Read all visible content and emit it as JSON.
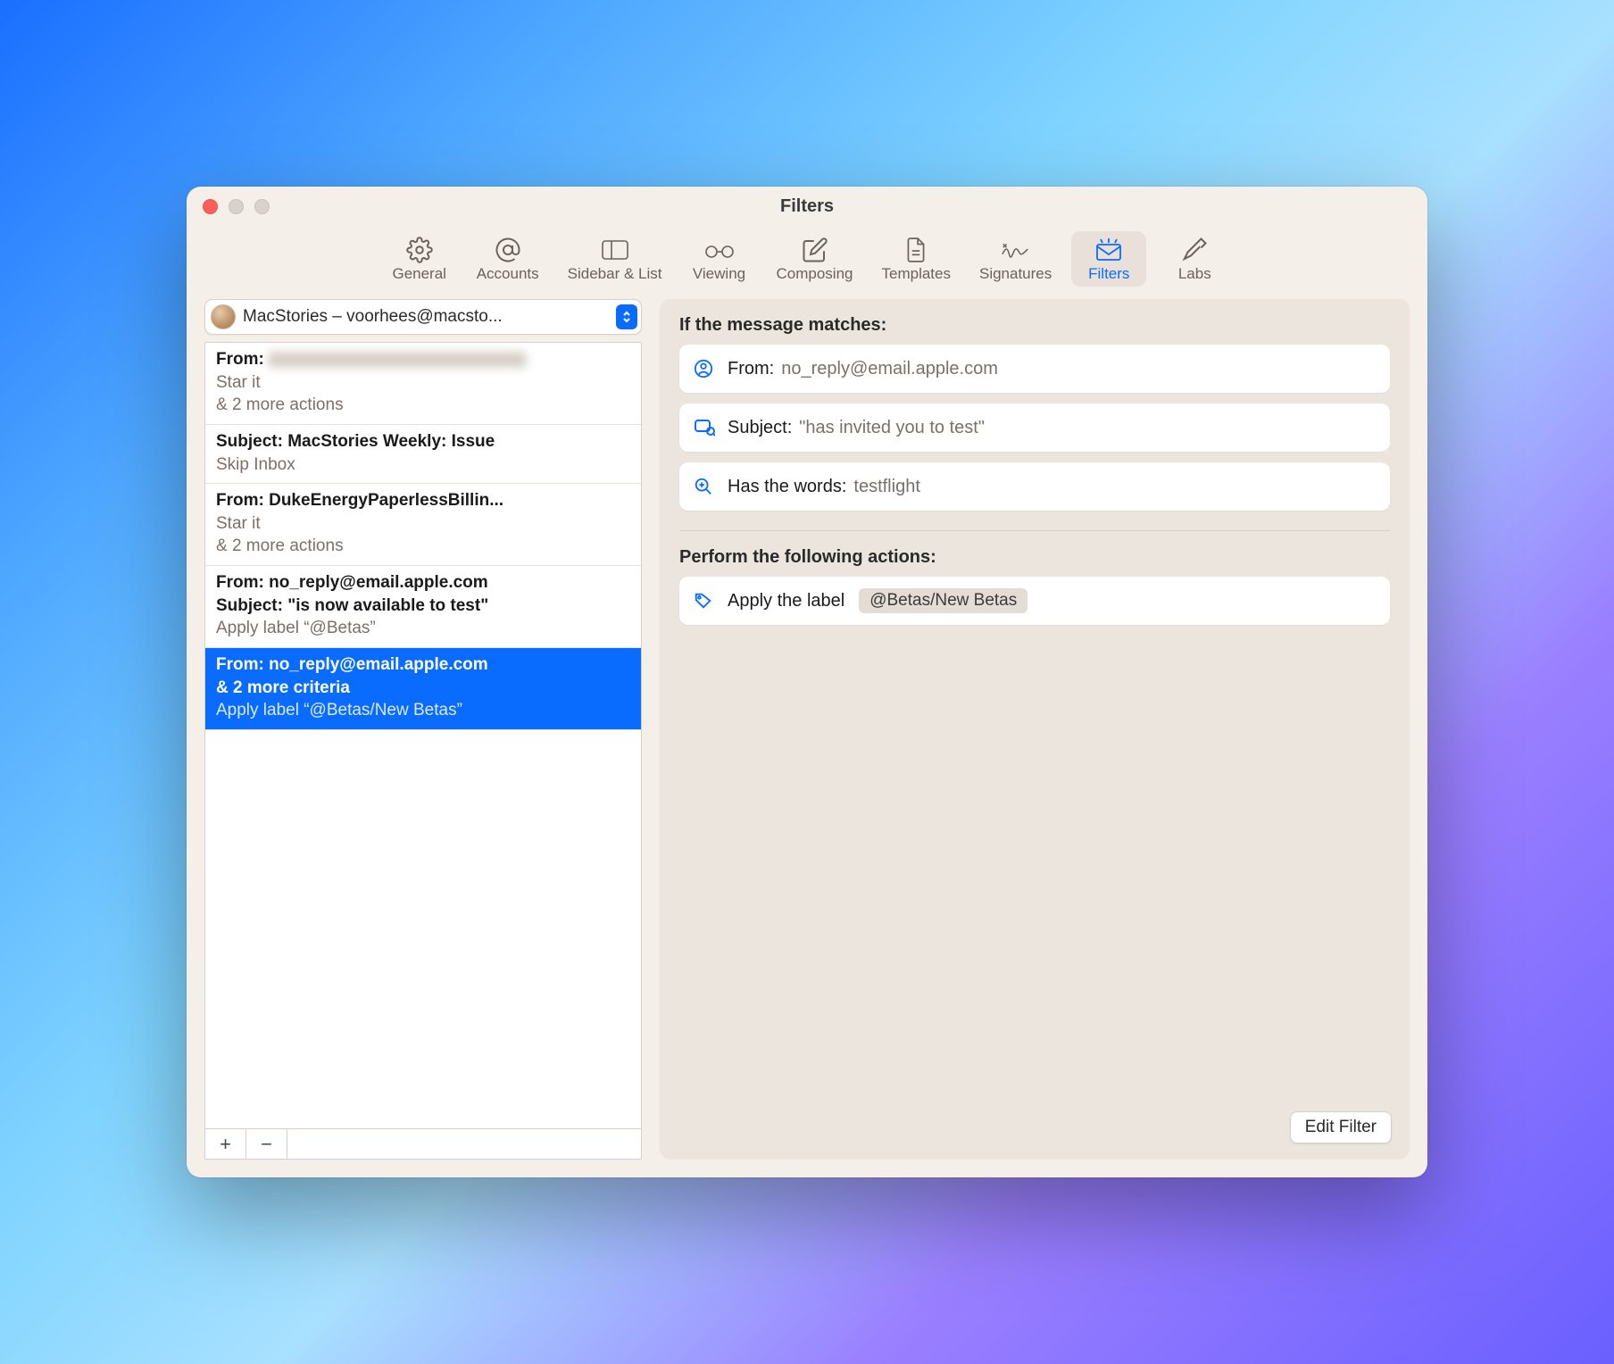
{
  "window": {
    "title": "Filters"
  },
  "toolbar": {
    "items": [
      {
        "label": "General"
      },
      {
        "label": "Accounts"
      },
      {
        "label": "Sidebar & List"
      },
      {
        "label": "Viewing"
      },
      {
        "label": "Composing"
      },
      {
        "label": "Templates"
      },
      {
        "label": "Signatures"
      },
      {
        "label": "Filters"
      },
      {
        "label": "Labs"
      }
    ]
  },
  "account": {
    "display": "MacStories – voorhees@macsto..."
  },
  "filters": [
    {
      "line1a": "From:",
      "line1b": "",
      "line2": "Star it",
      "line3": "& 2 more actions",
      "redacted": true
    },
    {
      "line1a": "Subject: MacStories Weekly: Issue",
      "line2": "Skip Inbox",
      "line3": ""
    },
    {
      "line1a": "From: DukeEnergyPaperlessBillin...",
      "line2": "Star it",
      "line3": "& 2 more actions"
    },
    {
      "line1a": "From: no_reply@email.apple.com",
      "line1b": "Subject: \"is now available to test\"",
      "line2": "Apply label “@Betas”",
      "line3": ""
    },
    {
      "line1a": "From: no_reply@email.apple.com",
      "line1b": "& 2 more criteria",
      "line2": "Apply label “@Betas/New Betas”",
      "line3": "",
      "selected": true
    }
  ],
  "detail": {
    "match_heading": "If the message matches:",
    "conditions": [
      {
        "icon": "person",
        "label": "From:",
        "value": "no_reply@email.apple.com"
      },
      {
        "icon": "subject",
        "label": "Subject:",
        "value": "\"has invited you to test\""
      },
      {
        "icon": "search",
        "label": "Has the words:",
        "value": "testflight"
      }
    ],
    "actions_heading": "Perform the following actions:",
    "action_label_prefix": "Apply the label",
    "action_label_value": "@Betas/New Betas",
    "edit_button": "Edit Filter"
  }
}
